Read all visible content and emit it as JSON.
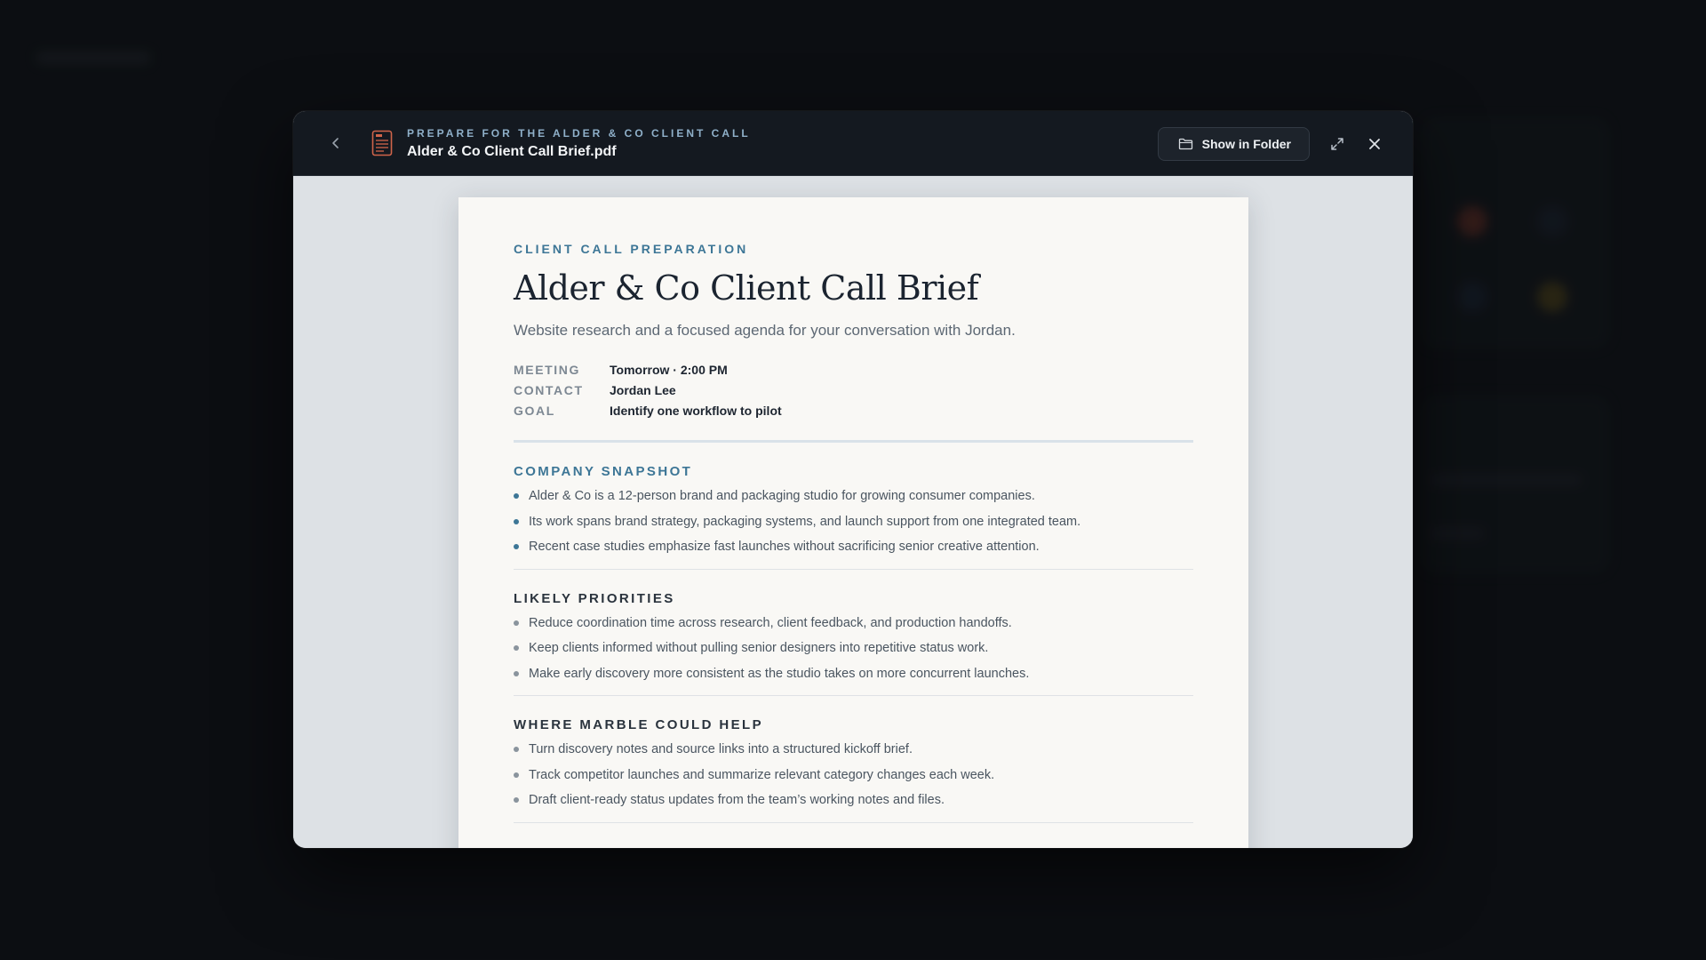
{
  "header": {
    "eyebrow": "PREPARE FOR THE ALDER & CO CLIENT CALL",
    "filename": "Alder & Co Client Call Brief.pdf",
    "show_in_folder_label": "Show in Folder",
    "icons": {
      "back": "chevron-left-icon",
      "file": "pdf-file-icon",
      "folder": "folder-icon",
      "expand": "expand-icon",
      "close": "close-icon"
    }
  },
  "document": {
    "eyebrow": "CLIENT CALL PREPARATION",
    "title": "Alder & Co Client Call Brief",
    "subtitle": "Website research and a focused agenda for your conversation with Jordan.",
    "meta": [
      {
        "label": "MEETING",
        "value": "Tomorrow · 2:00 PM"
      },
      {
        "label": "CONTACT",
        "value": "Jordan Lee"
      },
      {
        "label": "GOAL",
        "value": "Identify one workflow to pilot"
      }
    ],
    "sections": [
      {
        "heading": "COMPANY SNAPSHOT",
        "items": [
          "Alder & Co is a 12-person brand and packaging studio for growing consumer companies.",
          "Its work spans brand strategy, packaging systems, and launch support from one integrated team.",
          "Recent case studies emphasize fast launches without sacrificing senior creative attention."
        ]
      },
      {
        "heading": "LIKELY PRIORITIES",
        "items": [
          "Reduce coordination time across research, client feedback, and production handoffs.",
          "Keep clients informed without pulling senior designers into repetitive status work.",
          "Make early discovery more consistent as the studio takes on more concurrent launches."
        ]
      },
      {
        "heading": "WHERE MARBLE COULD HELP",
        "items": [
          "Turn discovery notes and source links into a structured kickoff brief.",
          "Track competitor launches and summarize relevant category changes each week.",
          "Draft client-ready status updates from the team’s working notes and files."
        ]
      }
    ]
  },
  "colors": {
    "accent": "#3d7696",
    "header_bg": "#141920",
    "page_bg": "#f9f8f5",
    "viewer_bg": "#dde1e5"
  }
}
